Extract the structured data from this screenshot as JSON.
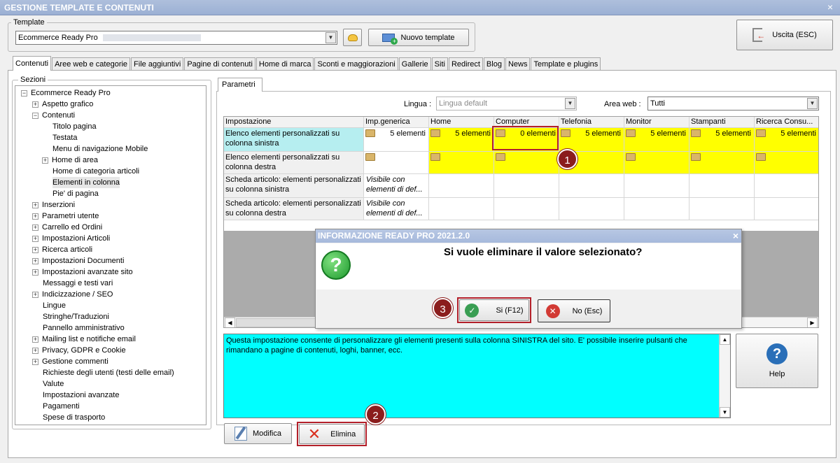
{
  "window": {
    "title": "GESTIONE TEMPLATE E CONTENUTI",
    "close": "×"
  },
  "template": {
    "legend": "Template",
    "value": "Ecommerce Ready Pro",
    "new_button": "Nuovo template",
    "exit_button": "Uscita (ESC)"
  },
  "tabs": [
    "Contenuti",
    "Aree web e categorie",
    "File aggiuntivi",
    "Pagine di contenuti",
    "Home di marca",
    "Sconti e maggiorazioni",
    "Gallerie",
    "Siti",
    "Redirect",
    "Blog",
    "News",
    "Template e plugins"
  ],
  "sections": {
    "legend": "Sezioni",
    "root": "Ecommerce Ready Pro",
    "items": [
      {
        "label": "Aspetto grafico",
        "expander": "+"
      },
      {
        "label": "Contenuti",
        "expander": "−"
      },
      {
        "label": "Titolo pagina",
        "expander": ""
      },
      {
        "label": "Testata",
        "expander": ""
      },
      {
        "label": "Menu di navigazione Mobile",
        "expander": ""
      },
      {
        "label": "Home di area",
        "expander": "+"
      },
      {
        "label": "Home di categoria articoli",
        "expander": ""
      },
      {
        "label": "Elementi in colonna",
        "expander": ""
      },
      {
        "label": "Pie' di pagina",
        "expander": ""
      },
      {
        "label": "Inserzioni",
        "expander": "+"
      },
      {
        "label": "Parametri utente",
        "expander": "+"
      },
      {
        "label": "Carrello ed Ordini",
        "expander": "+"
      },
      {
        "label": "Impostazioni Articoli",
        "expander": "+"
      },
      {
        "label": "Ricerca articoli",
        "expander": "+"
      },
      {
        "label": "Impostazioni Documenti",
        "expander": "+"
      },
      {
        "label": "Impostazioni avanzate sito",
        "expander": "+"
      },
      {
        "label": "Messaggi e testi vari",
        "expander": ""
      },
      {
        "label": "Indicizzazione / SEO",
        "expander": "+"
      },
      {
        "label": "Lingue",
        "expander": ""
      },
      {
        "label": "Stringhe/Traduzioni",
        "expander": ""
      },
      {
        "label": "Pannello amministrativo",
        "expander": ""
      },
      {
        "label": "Mailing list e notifiche email",
        "expander": "+"
      },
      {
        "label": "Privacy, GDPR e Cookie",
        "expander": "+"
      },
      {
        "label": "Gestione commenti",
        "expander": "+"
      },
      {
        "label": "Richieste degli utenti (testi delle email)",
        "expander": ""
      },
      {
        "label": "Valute",
        "expander": ""
      },
      {
        "label": "Impostazioni avanzate",
        "expander": ""
      },
      {
        "label": "Pagamenti",
        "expander": ""
      },
      {
        "label": "Spese di trasporto",
        "expander": ""
      }
    ]
  },
  "params": {
    "tab": "Parametri",
    "lingua_label": "Lingua :",
    "lingua_value": "Lingua default",
    "area_label": "Area web :",
    "area_value": "Tutti"
  },
  "grid": {
    "headers": [
      "Impostazione",
      "Imp.generica",
      "Home",
      "Computer",
      "Telefonia",
      "Monitor",
      "Stampanti",
      "Ricerca Consu..."
    ],
    "rows": [
      {
        "name": "Elenco elementi personalizzati su colonna sinistra",
        "values": [
          "5 elementi",
          "5 elementi",
          "0 elementi",
          "5 elementi",
          "5 elementi",
          "5 elementi",
          "5 elementi"
        ]
      },
      {
        "name": "Elenco elementi personalizzati su colonna destra",
        "values": [
          "",
          "",
          "",
          "",
          "",
          "",
          ""
        ]
      },
      {
        "name": "Scheda articolo: elementi personalizzati su colonna sinistra",
        "values": [
          "Visibile con elementi di def...",
          "",
          "",
          "",
          "",
          "",
          ""
        ]
      },
      {
        "name": "Scheda articolo: elementi personalizzati su colonna destra",
        "values": [
          "Visibile con elementi di def...",
          "",
          "",
          "",
          "",
          "",
          ""
        ]
      }
    ]
  },
  "description": "Questa impostazione consente di personalizzare gli elementi presenti sulla colonna SINISTRA del sito. E' possibile inserire pulsanti che rimandano a pagine di contenuti, loghi, banner, ecc.",
  "help_label": "Help",
  "actions": {
    "modifica": "Modifica",
    "elimina": "Elimina"
  },
  "dialog": {
    "title": "INFORMAZIONE READY PRO 2021.2.0",
    "message": "Si vuole eliminare il valore selezionato?",
    "yes": "Si (F12)",
    "no": "No (Esc)",
    "close": "×"
  },
  "callouts": [
    "1",
    "2",
    "3"
  ],
  "colors": {
    "highlight": "#ffff00",
    "description_bg": "#00ffff",
    "callout": "#8b1d1d"
  }
}
